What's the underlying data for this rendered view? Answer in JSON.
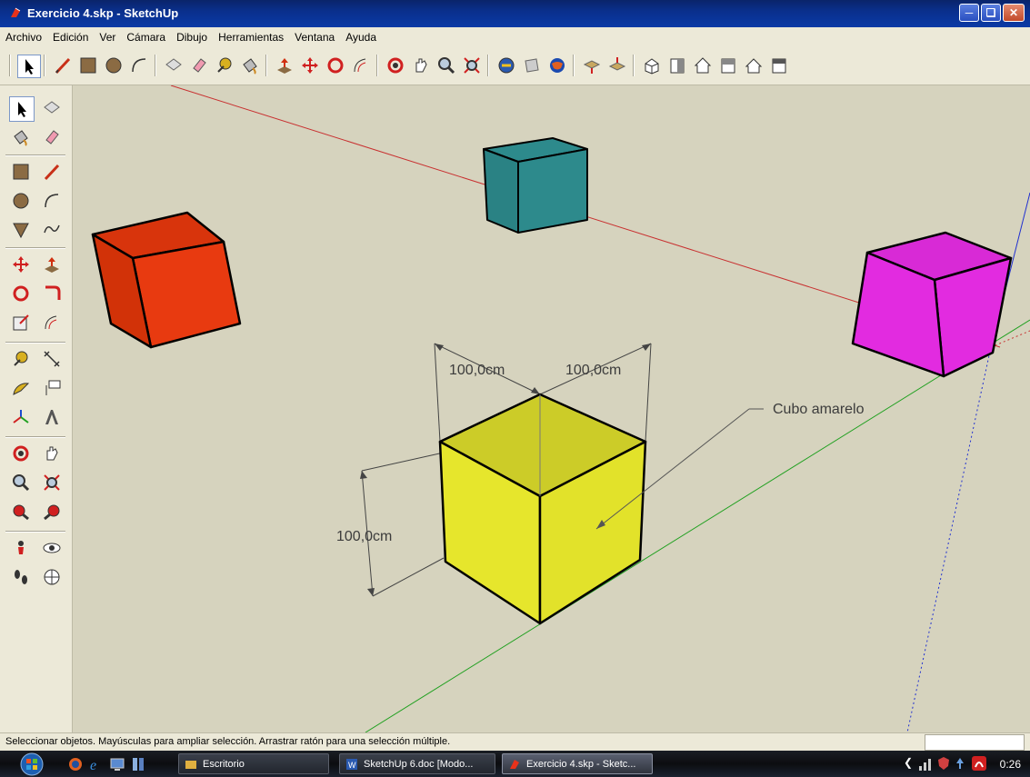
{
  "window": {
    "title": "Exercicio 4.skp - SketchUp"
  },
  "menu": [
    "Archivo",
    "Edición",
    "Ver",
    "Cámara",
    "Dibujo",
    "Herramientas",
    "Ventana",
    "Ayuda"
  ],
  "toolbar_icons": [
    "select-icon",
    "line-icon",
    "rectangle-icon",
    "circle-icon",
    "arc-icon",
    "make-component-icon",
    "eraser-icon",
    "tape-measure-icon",
    "paint-bucket-icon",
    "push-pull-icon",
    "move-icon",
    "rotate-icon",
    "offset-icon",
    "orbit-icon",
    "pan-icon",
    "zoom-icon",
    "zoom-extents-icon",
    "get-models-icon",
    "share-model-icon",
    "google-earth-icon",
    "upload-icon",
    "download-icon",
    "iso-view-icon",
    "front-view-icon",
    "top-view-icon",
    "right-view-icon",
    "back-view-icon",
    "left-view-icon"
  ],
  "model": {
    "dimension_labels": [
      "100,0cm",
      "100,0cm",
      "100,0cm"
    ],
    "leader_label": "Cubo amarelo",
    "cube_colors": {
      "orange": "#e83a10",
      "teal": "#2d8a8c",
      "magenta": "#e22be0",
      "yellow": "#e2e22a"
    }
  },
  "status": {
    "text": "Seleccionar objetos. Mayúsculas para ampliar selección. Arrastrar ratón para una selección múltiple."
  },
  "taskbar": {
    "buttons": [
      "Escritorio",
      "SketchUp 6.doc [Modo...",
      "Exercicio 4.skp - Sketc..."
    ],
    "clock": "0:26"
  }
}
